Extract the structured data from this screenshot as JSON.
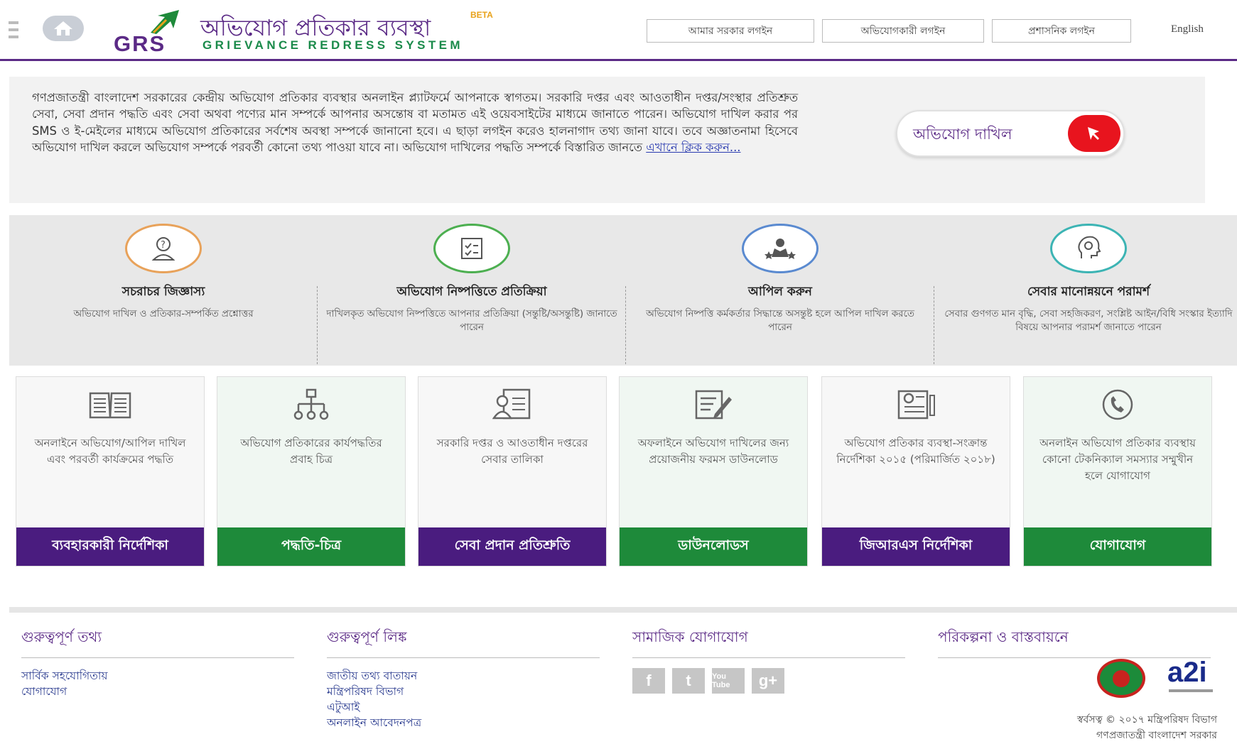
{
  "header": {
    "site_title": "অভিযোগ প্রতিকার ব্যবস্থা",
    "beta": "BETA",
    "logo_text": "GRS",
    "subtitle": "GRIEVANCE REDRESS SYSTEM",
    "buttons": [
      "আমার সরকার লগইন",
      "অভিযোগকারী লগইন",
      "প্রশাসনিক লগইন"
    ],
    "language": "English"
  },
  "intro": {
    "text": "গণপ্রজাতন্ত্রী বাংলাদেশ সরকারের কেন্দ্রীয় অভিযোগ প্রতিকার ব্যবস্থার অনলাইন প্ল্যাটফর্মে আপনাকে স্বাগতম। সরকারি দপ্তর এবং আওতাধীন দপ্তর/সংস্থার প্রতিশ্রুত সেবা, সেবা প্রদান পদ্ধতি এবং সেবা অথবা পণ্যের মান সম্পর্কে আপনার অসন্তোষ বা মতামত এই ওয়েবসাইটের মাধ্যমে জানাতে পারেন। অভিযোগ দাখিল করার পর SMS ও ই-মেইলের মাধ্যমে অভিযোগ প্রতিকারের সর্বশেষ অবস্থা সম্পর্কে জানানো হবে। এ ছাড়া লগইন করেও হালনাগাদ তথ্য জানা যাবে। তবে অজ্ঞাতনামা হিসেবে অভিযোগ দাখিল করলে অভিযোগ সম্পর্কে পরবর্তী কোনো তথ্য পাওয়া যাবে না। অভিযোগ দাখিলের পদ্ধতি সম্পর্কে বিস্তারিত জানতে ",
    "link": "এখানে ক্লিক করুন...",
    "submit_label": "অভিযোগ দাখিল"
  },
  "features": [
    {
      "title": "সচরাচর জিজ্ঞাস্য",
      "desc": "অভিযোগ দাখিল ও প্রতিকার-সম্পর্কিত প্রশ্নোত্তর",
      "icon": "question-person-icon",
      "color": "#e8a25a"
    },
    {
      "title": "অভিযোগ নিষ্পত্তিতে প্রতিক্রিয়া",
      "desc": "দাখিলকৃত অভিযোগ নিষ্পত্তিতে আপনার প্রতিক্রিয়া (সন্তুষ্টি/অসন্তুষ্টি) জানাতে পারেন",
      "icon": "clipboard-icon",
      "color": "#4caf50"
    },
    {
      "title": "আপিল করুন",
      "desc": "অভিযোগ নিষ্পত্তি কর্মকর্তার সিদ্ধান্তে অসন্তুষ্ট হলে আপিল দাখিল করতে পারেন",
      "icon": "people-stars-icon",
      "color": "#5a8ad0"
    },
    {
      "title": "সেবার মানোন্নয়নে পরামর্শ",
      "desc": "সেবার গুণগত মান বৃদ্ধি, সেবা সহজিকরণ, সংশ্লিষ্ট আইন/বিধি সংস্কার ইত্যাদি বিষয়ে আপনার পরামর্শ জানাতে পারেন",
      "icon": "head-gear-icon",
      "color": "#3cb4b4"
    }
  ],
  "cards": [
    {
      "desc": "অনলাইনে অভিযোগ/আপিল দাখিল এবং পরবর্তী কার্যক্রমের পদ্ধতি",
      "button": "ব্যবহারকারী নির্দেশিকা",
      "icon": "book-icon",
      "theme": "purple"
    },
    {
      "desc": "অভিযোগ প্রতিকারের কার্যপদ্ধতির প্রবাহ চিত্র",
      "button": "পদ্ধতি-চিত্র",
      "icon": "flowchart-icon",
      "theme": "green"
    },
    {
      "desc": "সরকারি দপ্তর ও আওতাধীন দপ্তরের সেবার তালিকা",
      "button": "সেবা প্রদান প্রতিশ্রুতি",
      "icon": "document-person-icon",
      "theme": "purple"
    },
    {
      "desc": "অফলাইনে অভিযোগ দাখিলের জন্য প্রয়োজনীয় ফরমস ডাউনলোড",
      "button": "ডাউনলোডস",
      "icon": "form-edit-icon",
      "theme": "green"
    },
    {
      "desc": "অভিযোগ প্রতিকার ব্যবস্থা-সংক্রান্ত নির্দেশিকা ২০১৫ (পরিমার্জিত ২০১৮)",
      "button": "জিআরএস নির্দেশিকা",
      "icon": "certificate-icon",
      "theme": "purple"
    },
    {
      "desc": "অনলাইন অভিযোগ প্রতিকার ব্যবস্থায় কোনো টেকনিক্যাল সমস্যার সম্মুখীন হলে যোগাযোগ",
      "button": "যোগাযোগ",
      "icon": "phone-icon",
      "theme": "green"
    }
  ],
  "footer": {
    "important_info": {
      "title": "গুরুত্বপূর্ণ তথ্য",
      "links": [
        "সার্বিক সহযোগিতায়",
        "যোগাযোগ"
      ]
    },
    "important_links": {
      "title": "গুরুত্বপূর্ণ লিঙ্ক",
      "links": [
        "জাতীয় তথ্য বাতায়ন",
        "মন্ত্রিপরিষদ বিভাগ",
        "এটুআই",
        "অনলাইন আবেদনপত্র"
      ]
    },
    "social": {
      "title": "সামাজিক যোগাযোগ",
      "items": [
        "f",
        "t",
        "You Tube",
        "g+"
      ]
    },
    "planning": {
      "title": "পরিকল্পনা ও বাস্তবায়নে",
      "a2i": "a2i"
    },
    "copyright_line1": "স্বর্বসত্ব © ২০১৭ মন্ত্রিপরিষদ বিভাগ",
    "copyright_line2": "গণপ্রজাতন্ত্রী বাংলাদেশ সরকার"
  },
  "colors": {
    "brand_purple": "#5b2a86",
    "brand_green": "#1e8a3a",
    "accent_red": "#e8141e"
  }
}
